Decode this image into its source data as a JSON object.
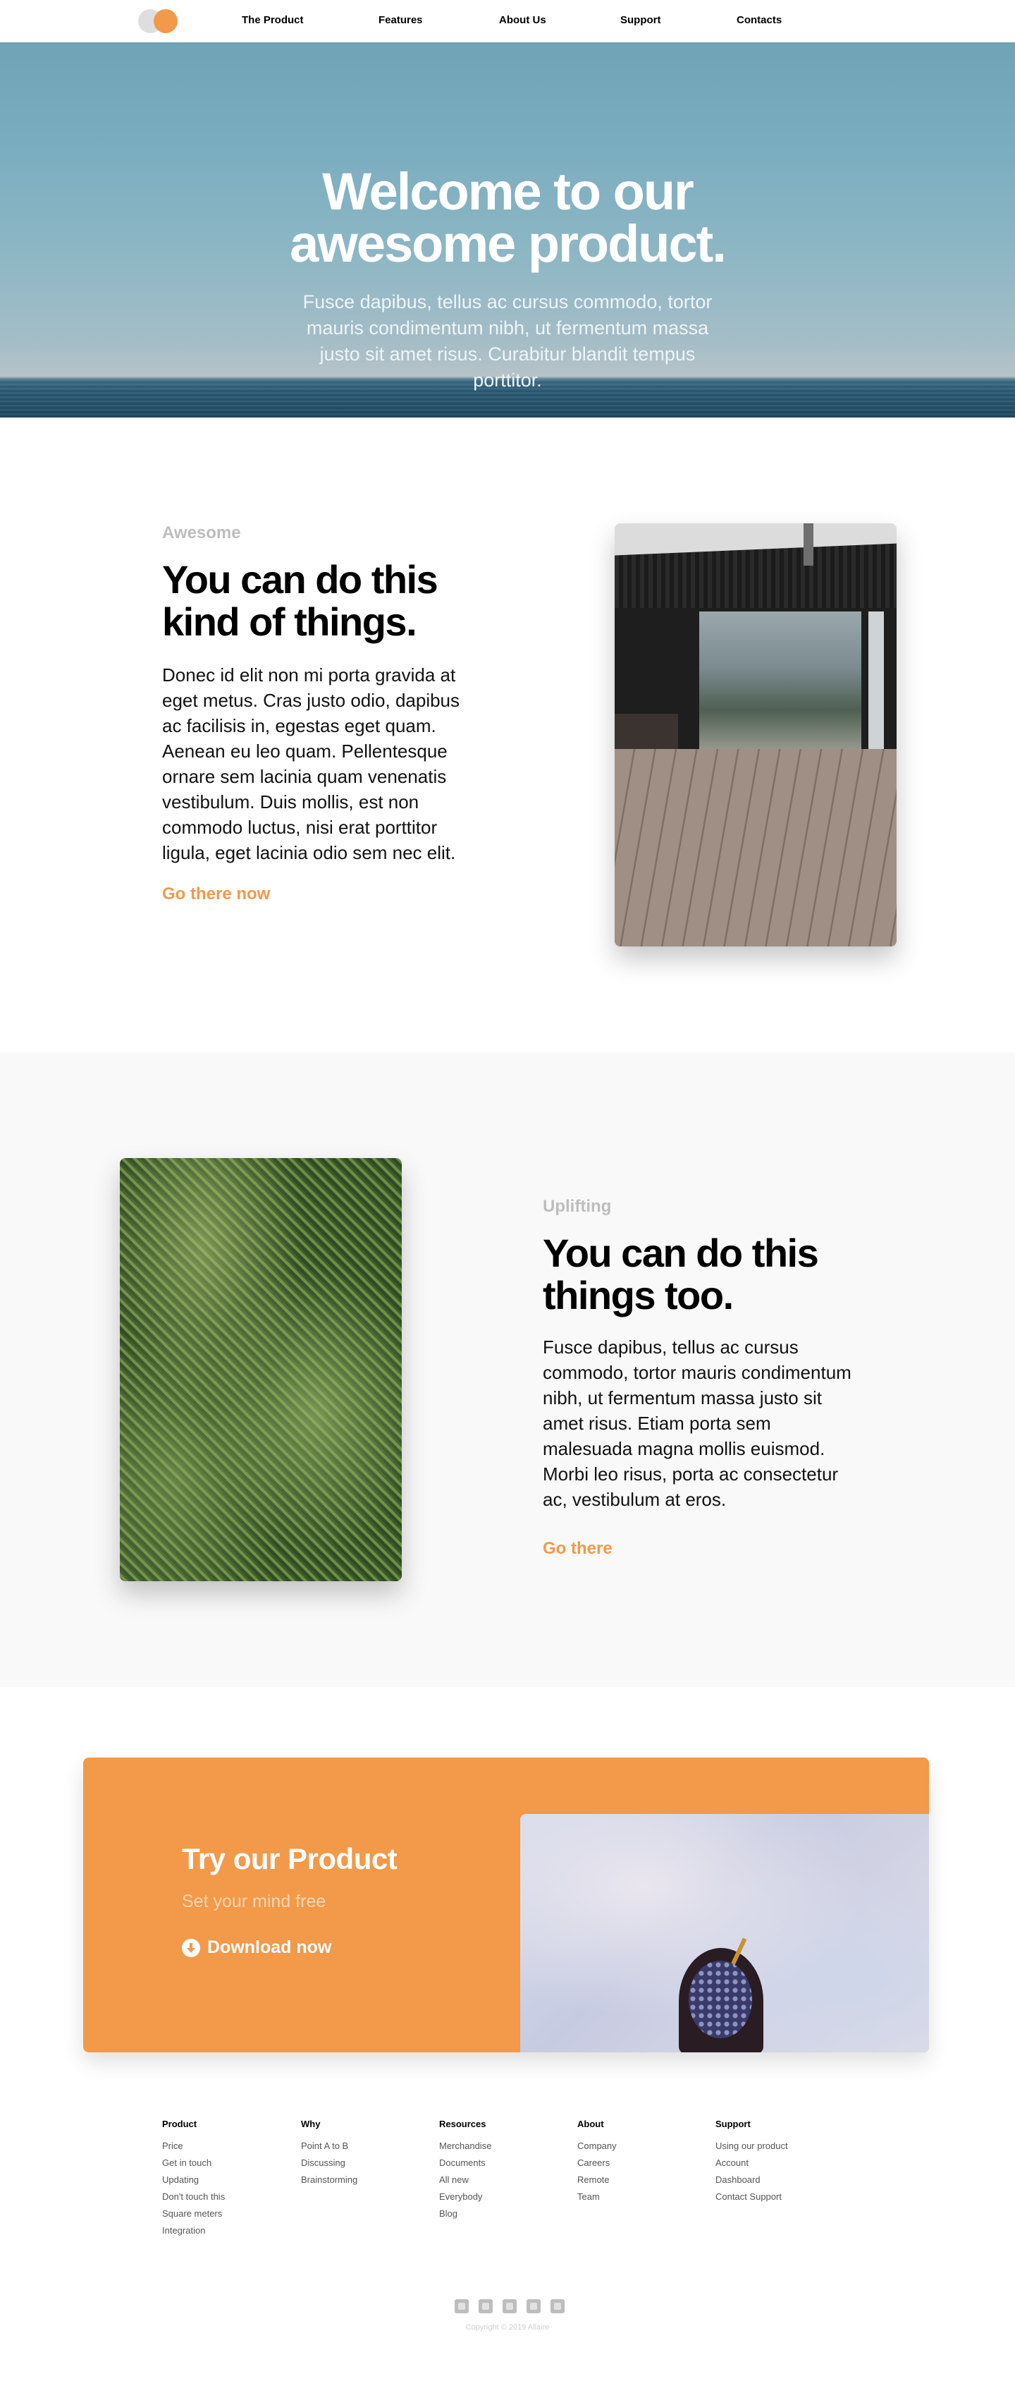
{
  "nav": {
    "links": [
      "The Product",
      "Features",
      "About Us",
      "Support",
      "Contacts"
    ]
  },
  "hero": {
    "title_line1": "Welcome to our",
    "title_line2": "awesome product.",
    "subtitle": "Fusce dapibus, tellus ac cursus commodo, tortor mauris condimentum nibh, ut fermentum massa justo sit amet risus. Curabitur blandit tempus porttitor."
  },
  "section1": {
    "eyebrow": "Awesome",
    "title_line1": "You can do this",
    "title_line2": "kind of things.",
    "body": "Donec id elit non mi porta gravida at eget metus. Cras justo odio, dapibus ac facilisis in, egestas eget quam. Aenean eu leo quam. Pellentesque ornare sem lacinia quam venenatis vestibulum. Duis mollis, est non commodo luctus, nisi erat porttitor ligula, eget lacinia odio sem nec elit.",
    "link": "Go there now"
  },
  "section2": {
    "eyebrow": "Uplifting",
    "title_line1": "You can do this",
    "title_line2": "things too.",
    "body": "Fusce dapibus, tellus ac cursus commodo, tortor mauris condimentum nibh, ut fermentum massa justo sit amet risus. Etiam porta sem malesuada magna mollis euismod. Morbi leo risus, porta ac consectetur ac, vestibulum at eros.",
    "link": "Go there"
  },
  "cta": {
    "title": "Try our Product",
    "subtitle": "Set your mind free",
    "download": "Download now"
  },
  "footer": {
    "columns": [
      {
        "heading": "Product",
        "links": [
          "Price",
          "Get in touch",
          "Updating",
          "Don't touch this",
          "Square meters",
          "Integration"
        ]
      },
      {
        "heading": "Why",
        "links": [
          "Point A to B",
          "Discussing",
          "Brainstorming"
        ]
      },
      {
        "heading": "Resources",
        "links": [
          "Merchandise",
          "Documents",
          "All new",
          "Everybody",
          "Blog"
        ]
      },
      {
        "heading": "About",
        "links": [
          "Company",
          "Careers",
          "Remote",
          "Team"
        ]
      },
      {
        "heading": "Support",
        "links": [
          "Using our product",
          "Account",
          "Dashboard",
          "Contact Support"
        ]
      }
    ],
    "social_icons": [
      "twitter-icon",
      "facebook-icon",
      "instagram-icon",
      "youtube-icon",
      "github-icon"
    ],
    "copyright": "Copyright © 2019 Allaire"
  },
  "colors": {
    "accent": "#f2994a",
    "muted": "#bdbdbd"
  }
}
